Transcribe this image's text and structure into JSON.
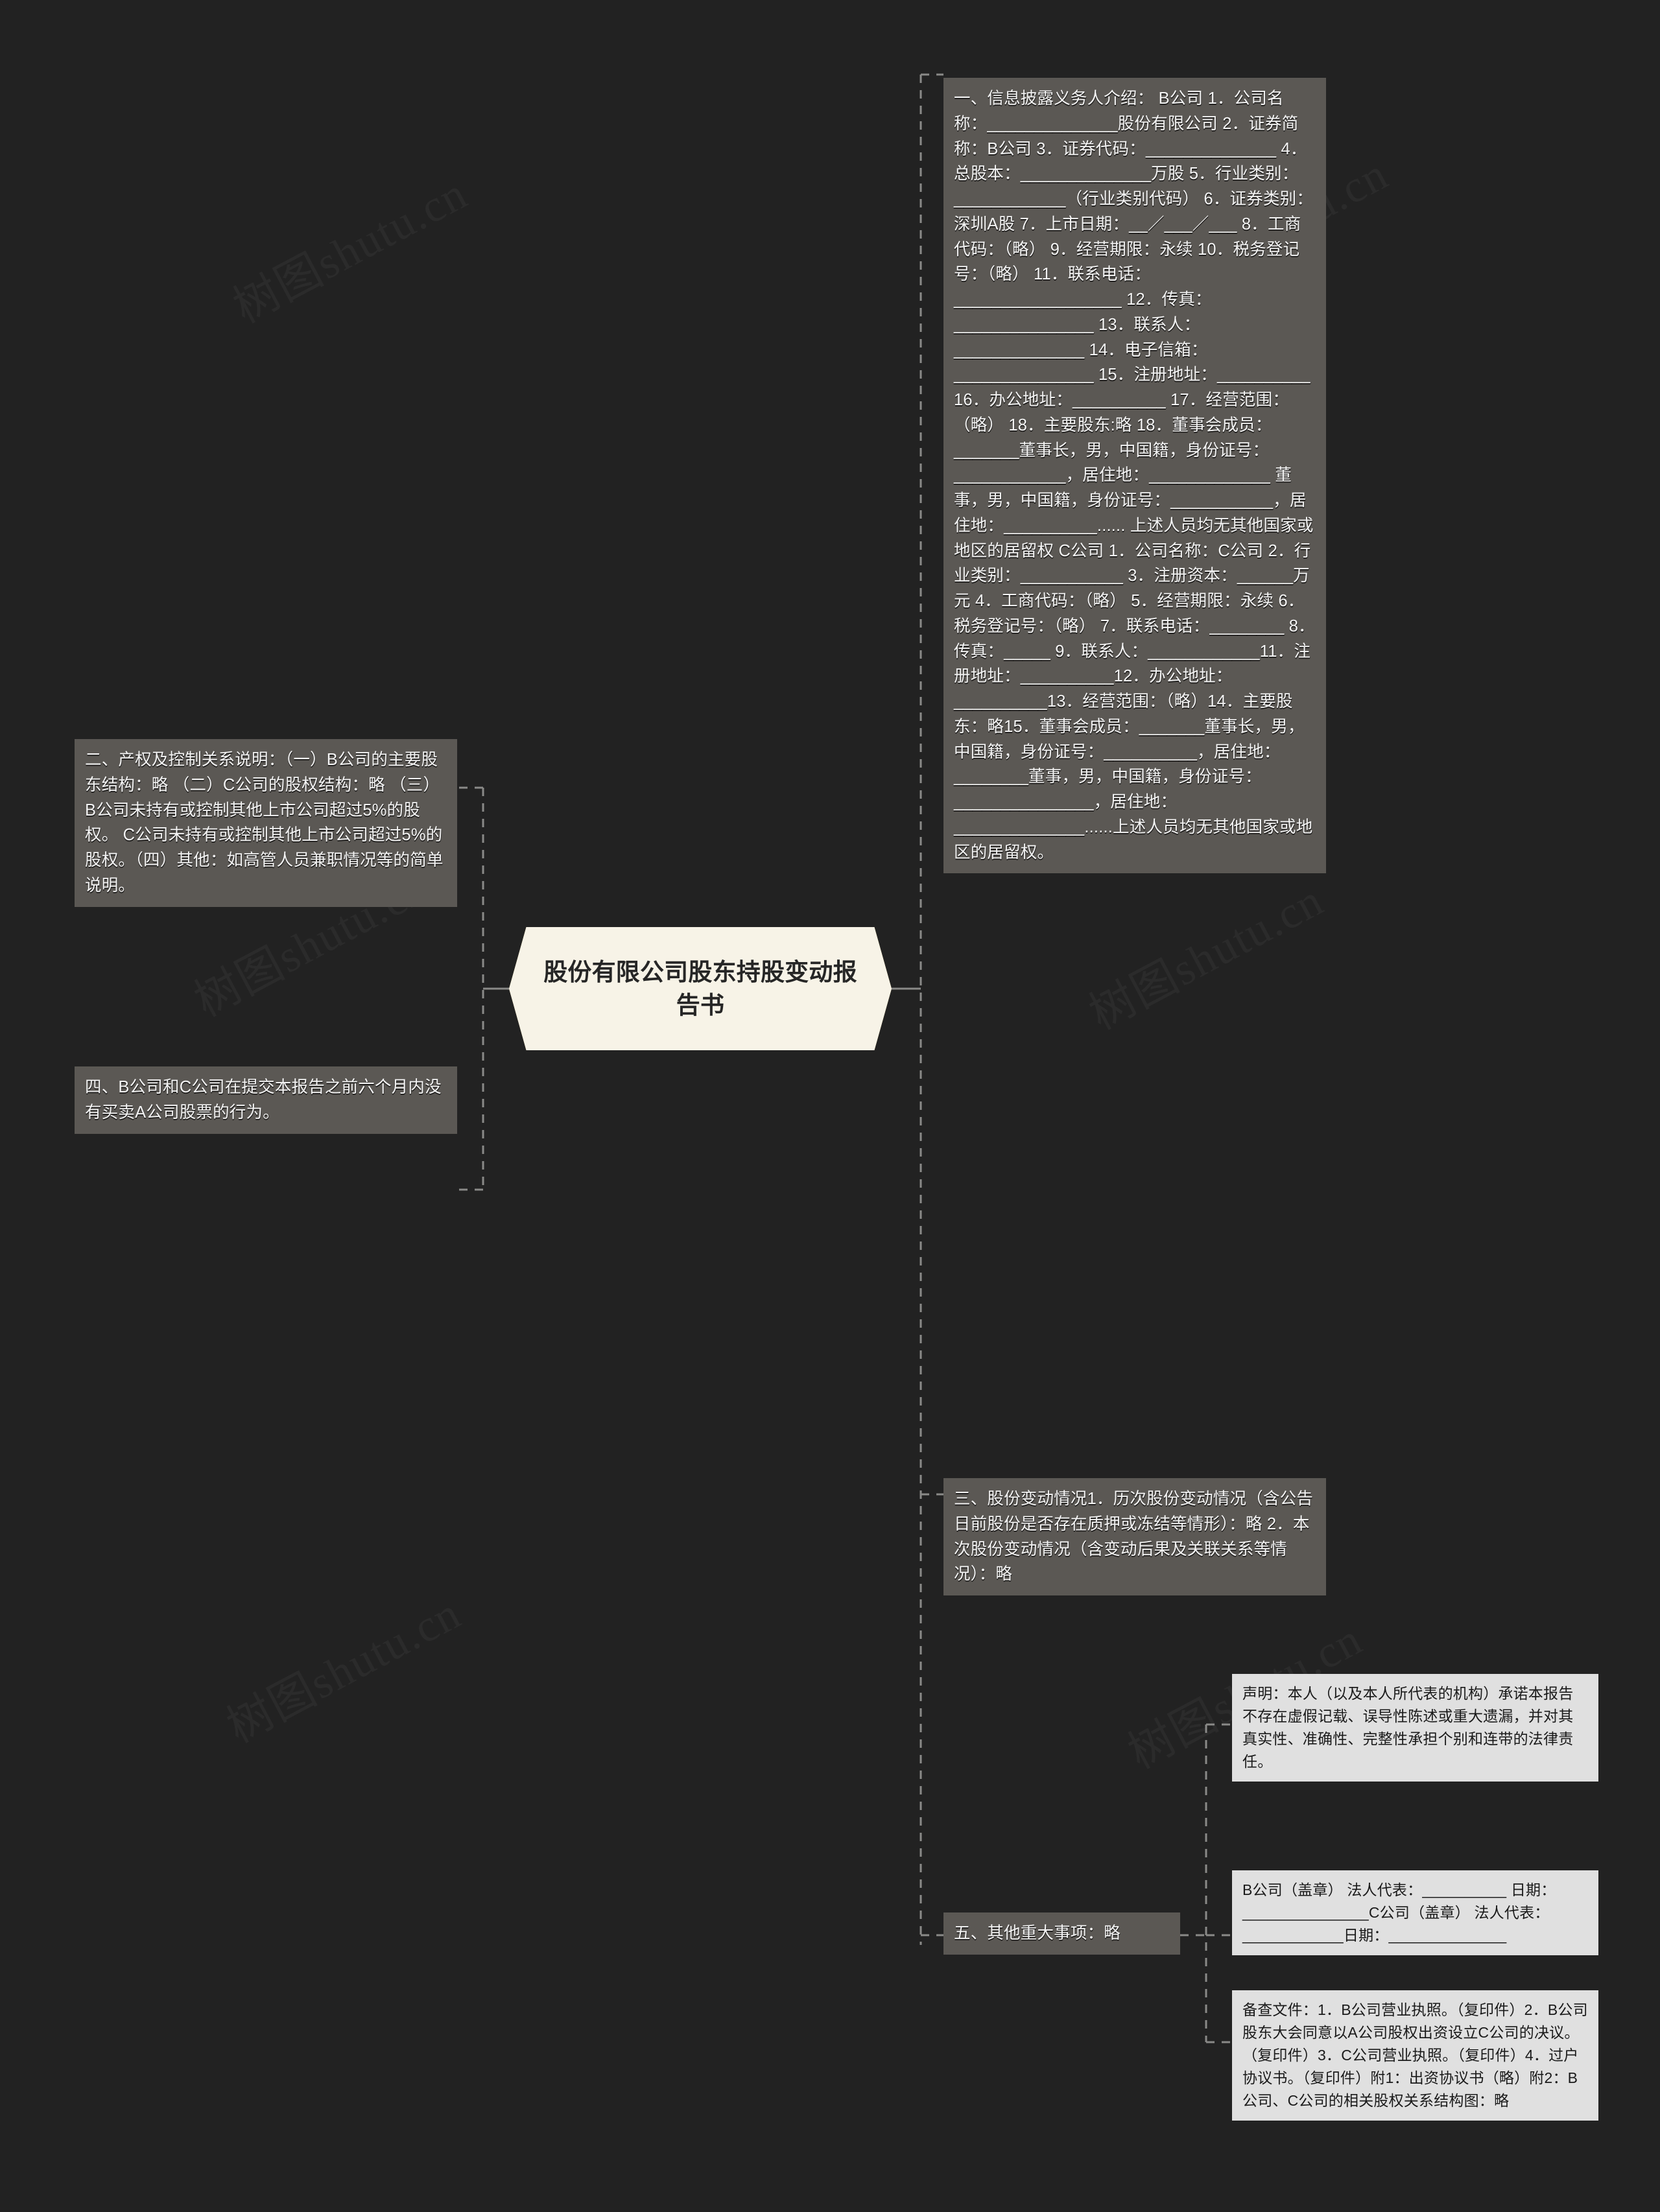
{
  "center": {
    "title": "股份有限公司股东持股变动报告书",
    "color": "#f2cf6d"
  },
  "theme": {
    "background": "#222222",
    "dark_node": "#5b5854",
    "light_node": "#e0e0e0",
    "connector": "#8a8a88"
  },
  "watermark": "树图shutu.cn",
  "branches": {
    "left": [
      {
        "id": "node-ownership-control",
        "text": "二、产权及控制关系说明：（一）B公司的主要股东结构：略 （二）C公司的股权结构：略 （三）B公司未持有或控制其他上市公司超过5%的股权。 C公司未持有或控制其他上市公司超过5%的股权。（四）其他：如高管人员兼职情况等的简单说明。"
      },
      {
        "id": "node-no-trading",
        "text": "四、B公司和C公司在提交本报告之前六个月内没有买卖A公司股票的行为。"
      }
    ],
    "right": [
      {
        "id": "node-discloser-intro",
        "text": "一、信息披露义务人介绍： B公司 1．公司名称：______________股份有限公司 2．证券简称：B公司 3．证券代码：______________ 4．总股本：______________万股 5．行业类别：____________（行业类别代码） 6．证券类别：深圳A股 7．上市日期：__／___／___ 8．工商代码：（略） 9．经营期限：永续 10．税务登记号：（略） 11．联系电话：__________________ 12．传真：_______________ 13．联系人：______________ 14．电子信箱：_______________ 15．注册地址：__________ 16．办公地址：__________ 17．经营范围：（略） 18．主要股东:略 18．董事会成员：_______董事长，男，中国籍，身份证号：____________，居住地：_____________ 董事，男，中国籍，身份证号：___________，居住地：__________...... 上述人员均无其他国家或地区的居留权 C公司 1．公司名称：C公司 2．行业类别：___________ 3．注册资本：______万元 4．工商代码：（略） 5．经营期限：永续 6．税务登记号：（略） 7．联系电话：________ 8．传真：_____ 9．联系人：____________11．注册地址：__________12．办公地址：__________13．经营范围：（略）14．主要股东：略15．董事会成员：_______董事长，男，中国籍，身份证号：__________，居住地：________董事，男，中国籍，身份证号：_______________，居住地：______________......上述人员均无其他国家或地区的居留权。"
      },
      {
        "id": "node-share-changes",
        "text": "三、股份变动情况1．历次股份变动情况（含公告日前股份是否存在质押或冻结等情形）：略 2．本次股份变动情况（含变动后果及关联关系等情况）：略"
      },
      {
        "id": "node-other-matters",
        "text": "五、其他重大事项：略"
      }
    ],
    "other_matters_children": [
      {
        "id": "node-declaration",
        "text": "声明：本人（以及本人所代表的机构）承诺本报告不存在虚假记载、误导性陈述或重大遗漏，并对其真实性、准确性、完整性承担个别和连带的法律责任。"
      },
      {
        "id": "node-signature-block",
        "text": "B公司（盖章） 法人代表：__________ 日期：_______________C公司（盖章） 法人代表：____________日期：______________"
      },
      {
        "id": "node-reference-documents",
        "text": "备查文件：1．B公司营业执照。（复印件）2．B公司股东大会同意以A公司股权出资设立C公司的决议。（复印件）3．C公司营业执照。（复印件）4．过户协议书。（复印件）附1：出资协议书（略）附2：B公司、C公司的相关股权关系结构图：略"
      }
    ]
  }
}
